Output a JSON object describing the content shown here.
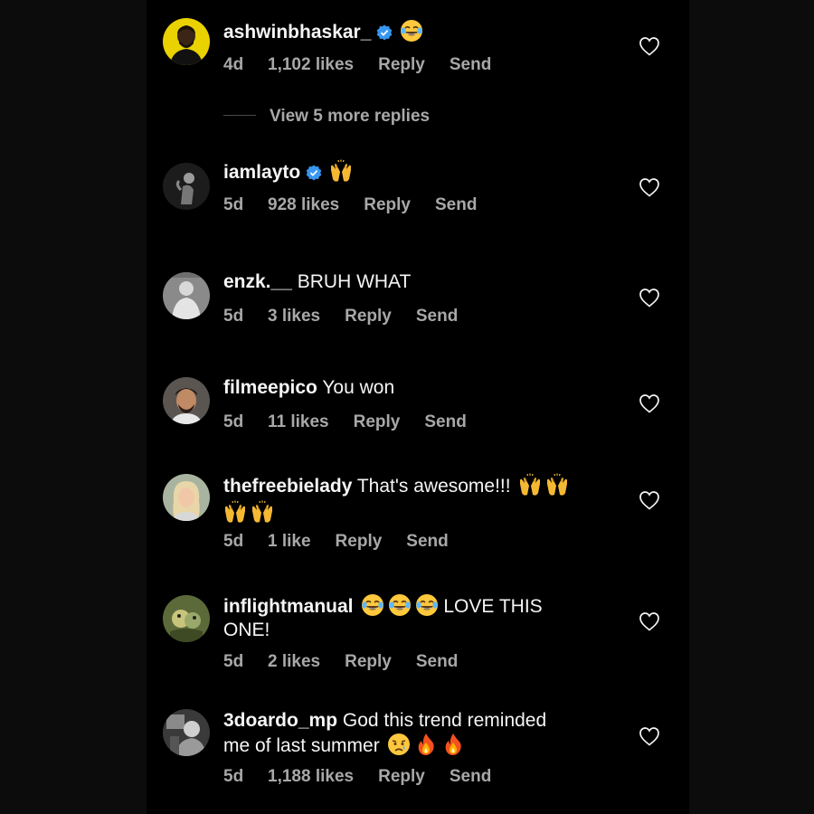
{
  "view_more_label": "View 5 more replies",
  "reply_label": "Reply",
  "send_label": "Send",
  "colors": {
    "text": "#f5f5f5",
    "meta": "#a8a8a8",
    "verified": "#3897f0",
    "background": "#000000"
  },
  "comments": [
    {
      "username": "ashwinbhaskar_",
      "verified": true,
      "line1": "",
      "line2": "",
      "emojis": [
        "joy-emoji"
      ],
      "age": "4d",
      "likes": "1,102 likes",
      "avatar": "avatar-yellow-bearded-man"
    },
    {
      "username": "iamlayto",
      "verified": true,
      "line1": "",
      "line2": "",
      "emojis": [
        "raising-hands-emoji"
      ],
      "age": "5d",
      "likes": "928 likes",
      "avatar": "avatar-dark-figure"
    },
    {
      "username": "enzk.__",
      "verified": false,
      "line1": "BRUH WHAT",
      "line2": "",
      "age": "5d",
      "likes": "3 likes",
      "avatar": "avatar-grey-person"
    },
    {
      "username": "filmeepico",
      "verified": false,
      "line1": "You won",
      "line2": "",
      "age": "5d",
      "likes": "11 likes",
      "avatar": "avatar-man-face"
    },
    {
      "username": "thefreebielady",
      "verified": false,
      "line1": "That's awesome!!!",
      "line2": "",
      "emojis": [
        "raising-hands-emoji",
        "raising-hands-emoji"
      ],
      "emojis_line2": [
        "raising-hands-emoji",
        "raising-hands-emoji"
      ],
      "age": "5d",
      "likes": "1 like",
      "avatar": "avatar-blonde-woman"
    },
    {
      "username": "inflightmanual",
      "verified": false,
      "line1": "LOVE THIS",
      "line2": "ONE!",
      "emojis_before": [
        "joy-emoji",
        "joy-emoji",
        "joy-emoji"
      ],
      "age": "5d",
      "likes": "2 likes",
      "avatar": "avatar-birds"
    },
    {
      "username": "3doardo_mp",
      "verified": false,
      "line1": "God this trend reminded",
      "line2": "me of last summer",
      "emojis_line2": [
        "crying-emoji",
        "fire-emoji",
        "fire-emoji"
      ],
      "age": "5d",
      "likes": "1,188 likes",
      "avatar": "avatar-mono-man"
    }
  ]
}
